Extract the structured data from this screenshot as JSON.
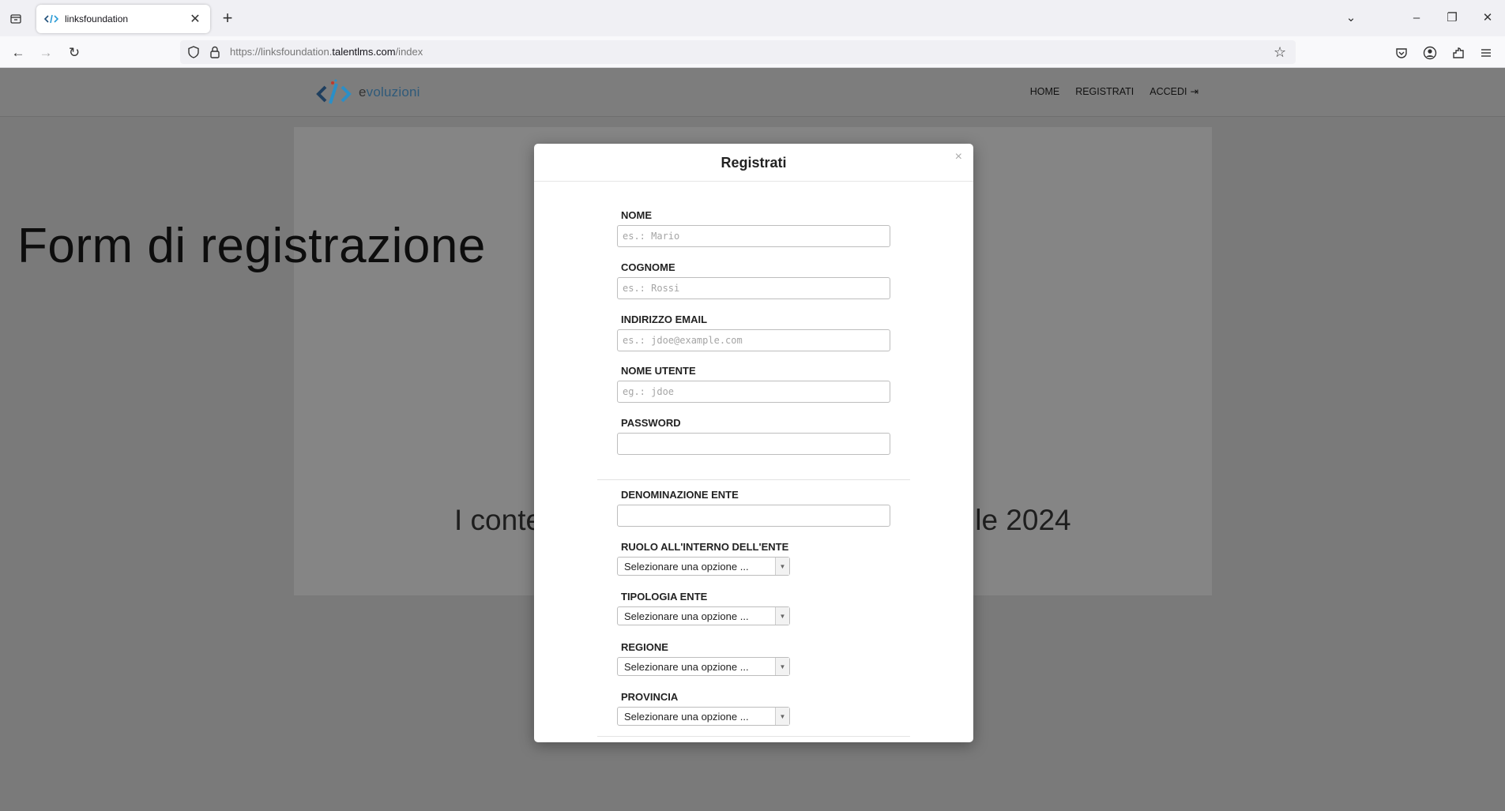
{
  "browser": {
    "tab_title": "linksfoundation",
    "url_prefix": "https://linksfoundation.",
    "url_domain": "talentlms.com",
    "url_path": "/index"
  },
  "site": {
    "logo_text_e": "e",
    "logo_text_rest": "voluzioni",
    "nav": {
      "home": "HOME",
      "register": "REGISTRATI",
      "login": "ACCEDI"
    }
  },
  "page": {
    "hero_title": "Form di registrazione",
    "card_text_left": "I conte",
    "card_text_right": "ile 2024"
  },
  "modal": {
    "title": "Registrati",
    "close": "×",
    "fields": {
      "nome": {
        "label": "NOME",
        "placeholder": "es.: Mario"
      },
      "cognome": {
        "label": "COGNOME",
        "placeholder": "es.: Rossi"
      },
      "email": {
        "label": "INDIRIZZO EMAIL",
        "placeholder": "es.: jdoe@example.com"
      },
      "username": {
        "label": "NOME UTENTE",
        "placeholder": "eg.: jdoe"
      },
      "password": {
        "label": "PASSWORD",
        "placeholder": ""
      },
      "ente": {
        "label": "DENOMINAZIONE ENTE",
        "placeholder": ""
      }
    },
    "selects": {
      "ruolo": {
        "label": "RUOLO ALL'INTERNO DELL'ENTE",
        "value": "Selezionare una opzione ..."
      },
      "tipologia": {
        "label": "TIPOLOGIA ENTE",
        "value": "Selezionare una opzione ..."
      },
      "regione": {
        "label": "REGIONE",
        "value": "Selezionare una opzione ..."
      },
      "provincia": {
        "label": "PROVINCIA",
        "value": "Selezionare una opzione ..."
      }
    }
  }
}
